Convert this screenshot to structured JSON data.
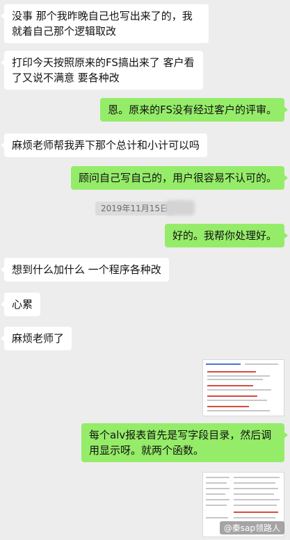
{
  "messages": [
    {
      "side": "left",
      "text": "没事  那个我昨晚自己也写出来了的，我就着自己那个逻辑取改"
    },
    {
      "side": "left",
      "text": "打印今天按照原来的FS搞出来了 客户看了又说不满意 要各种改"
    },
    {
      "side": "right",
      "text": "恩。原来的FS没有经过客户的评审。"
    },
    {
      "side": "left",
      "text": "麻烦老师帮我弄下那个总计和小计可以吗"
    },
    {
      "side": "right",
      "text": "顾问自己写自己的，用户很容易不认可的。"
    },
    {
      "side": "right",
      "text": "好的。我帮你处理好。"
    },
    {
      "side": "left",
      "text": "想到什么加什么  一个程序各种改"
    },
    {
      "side": "left",
      "text": "心累"
    },
    {
      "side": "left",
      "text": "麻烦老师了"
    },
    {
      "side": "right",
      "text": "每个alv报表首先是写字段目录，然后调用显示呀。就两个函数。"
    }
  ],
  "timestamp": "2019年11月15日",
  "watermark": "@秦sap领路人"
}
